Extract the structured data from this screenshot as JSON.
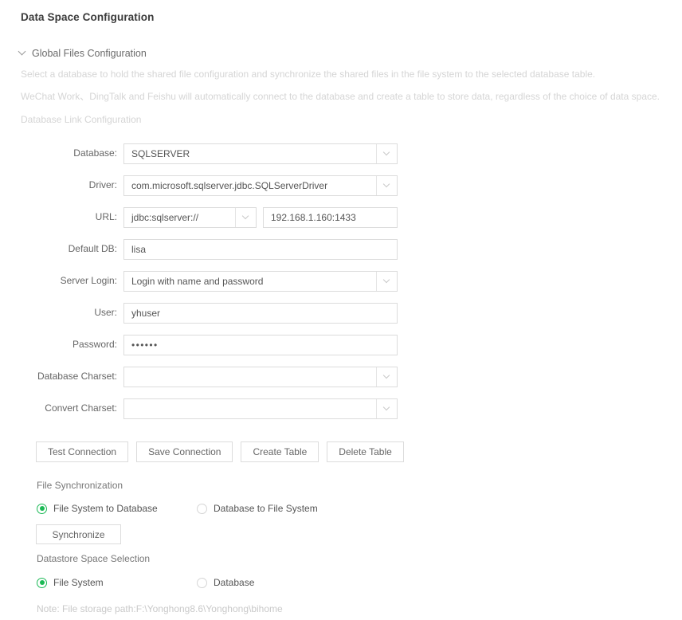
{
  "page": {
    "title": "Data Space Configuration"
  },
  "section": {
    "header_label": "Global Files Configuration",
    "chevron_icon": "chevron-down-icon",
    "hints": [
      "Select a database to hold the shared file configuration and synchronize the shared files in the file system to the selected database table.",
      "WeChat Work、DingTalk and Feishu will automatically connect to the database and create a table to store data, regardless of the choice of data space.",
      "Database Link Configuration"
    ]
  },
  "form": {
    "fields": [
      {
        "label": "Database:",
        "value": "SQLSERVER",
        "type": "select"
      },
      {
        "label": "Driver:",
        "value": "com.microsoft.sqlserver.jdbc.SQLServerDriver",
        "type": "select"
      },
      {
        "label": "URL:",
        "value": "jdbc:sqlserver://",
        "type": "url",
        "host_value": "192.168.1.160:1433"
      },
      {
        "label": "Default DB:",
        "value": "lisa",
        "type": "text"
      },
      {
        "label": "Server Login:",
        "value": "Login with name and password",
        "type": "select"
      },
      {
        "label": "User:",
        "value": "yhuser",
        "type": "text"
      },
      {
        "label": "Password:",
        "value": "••••••",
        "type": "password"
      },
      {
        "label": "Database Charset:",
        "value": "",
        "type": "select"
      },
      {
        "label": "Convert Charset:",
        "value": "",
        "type": "select"
      }
    ]
  },
  "actions": {
    "test_connection": "Test Connection",
    "save_connection": "Save Connection",
    "create_table": "Create Table",
    "delete_table": "Delete Table",
    "synchronize": "Synchronize"
  },
  "file_sync": {
    "group_label": "File Synchronization",
    "options": [
      {
        "label": "File System to Database",
        "selected": true
      },
      {
        "label": "Database to File System",
        "selected": false
      }
    ]
  },
  "datastore": {
    "group_label": "Datastore Space Selection",
    "options": [
      {
        "label": "File System",
        "selected": true
      },
      {
        "label": "Database",
        "selected": false
      }
    ],
    "note": "Note: File storage path:F:\\Yonghong8.6\\Yonghong\\bihome"
  },
  "colors": {
    "accent_green": "#1bb955",
    "title_text": "#3b3b3b",
    "body_text": "#555555",
    "hint_text": "#d5d5d5",
    "border": "#dcdcdc"
  }
}
